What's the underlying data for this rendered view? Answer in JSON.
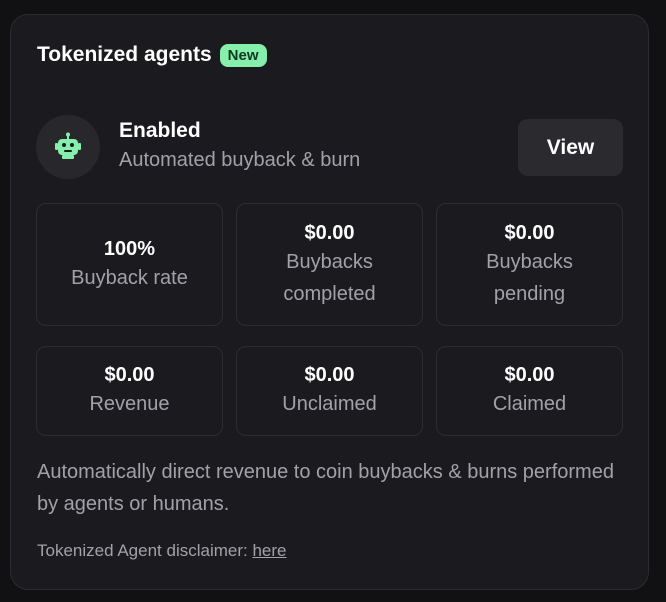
{
  "header": {
    "title": "Tokenized agents",
    "badge": "New"
  },
  "agent": {
    "status": "Enabled",
    "subtitle": "Automated buyback & burn",
    "view_label": "View",
    "icon": "robot-icon"
  },
  "stats": [
    {
      "value": "100%",
      "label": "Buyback rate"
    },
    {
      "value": "$0.00",
      "label": "Buybacks completed"
    },
    {
      "value": "$0.00",
      "label": "Buybacks pending"
    },
    {
      "value": "$0.00",
      "label": "Revenue"
    },
    {
      "value": "$0.00",
      "label": "Unclaimed"
    },
    {
      "value": "$0.00",
      "label": "Claimed"
    }
  ],
  "description": "Automatically direct revenue to coin buybacks & burns performed by agents or humans.",
  "disclaimer": {
    "text": "Tokenized Agent disclaimer: ",
    "link": "here"
  },
  "colors": {
    "badge_bg": "#86efac",
    "icon": "#86efac",
    "card_bg": "#1b1b1f"
  }
}
